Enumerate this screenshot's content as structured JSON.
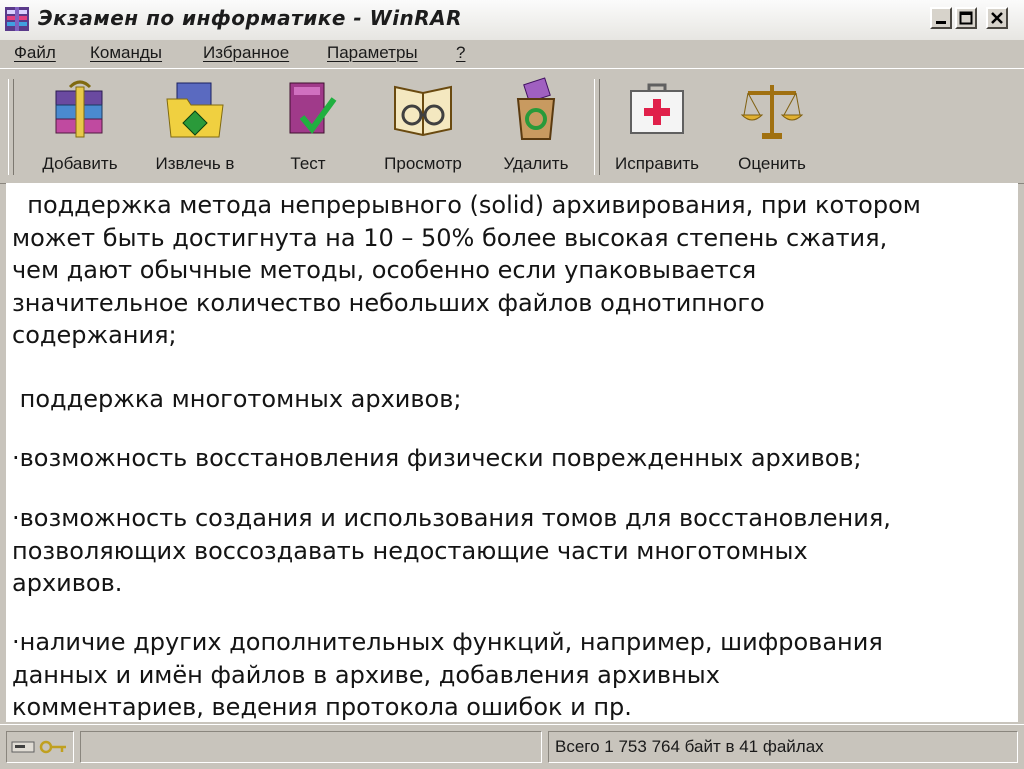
{
  "window": {
    "title": "Экзамен по информатике - WinRAR"
  },
  "menu": [
    {
      "label": "Файл"
    },
    {
      "label": "Команды"
    },
    {
      "label": "Избранное"
    },
    {
      "label": "Параметры"
    },
    {
      "label": "?"
    }
  ],
  "toolbar": [
    {
      "label": "Добавить",
      "icon": "archive-books-icon"
    },
    {
      "label": "Извлечь в",
      "icon": "extract-folder-icon"
    },
    {
      "label": "Тест",
      "icon": "test-check-icon"
    },
    {
      "label": "Просмотр",
      "icon": "view-book-glasses-icon"
    },
    {
      "label": "Удалить",
      "icon": "recycle-bin-icon"
    },
    {
      "label": "Исправить",
      "icon": "first-aid-kit-icon"
    },
    {
      "label": "Оценить",
      "icon": "scales-icon"
    }
  ],
  "content": {
    "paragraphs": [
      [
        "  поддержка метода непрерывного (solid) архивирования, при котором",
        "может быть достигнута на 10 – 50% более высокая степень сжатия,",
        "чем дают обычные методы, особенно если упаковывается",
        "значительное количество небольших файлов однотипного",
        "содержания;"
      ],
      [
        " поддержка многотомных архивов;"
      ],
      [
        "·возможность восстановления физически поврежденных архивов;"
      ],
      [
        "·возможность создания и использования томов для восстановления,",
        "позволяющих воссоздавать недостающие части многотомных",
        "архивов."
      ],
      [
        "·наличие других дополнительных функций, например, шифрования",
        "данных и имён файлов в архиве, добавления архивных",
        "комментариев, ведения протокола ошибок и пр."
      ]
    ]
  },
  "status": {
    "summary": "Всего 1 753 764 байт в 41 файлах"
  },
  "colors": {
    "window_bg": "#c8c4bc",
    "content_bg": "#ffffff",
    "text": "#141414"
  }
}
